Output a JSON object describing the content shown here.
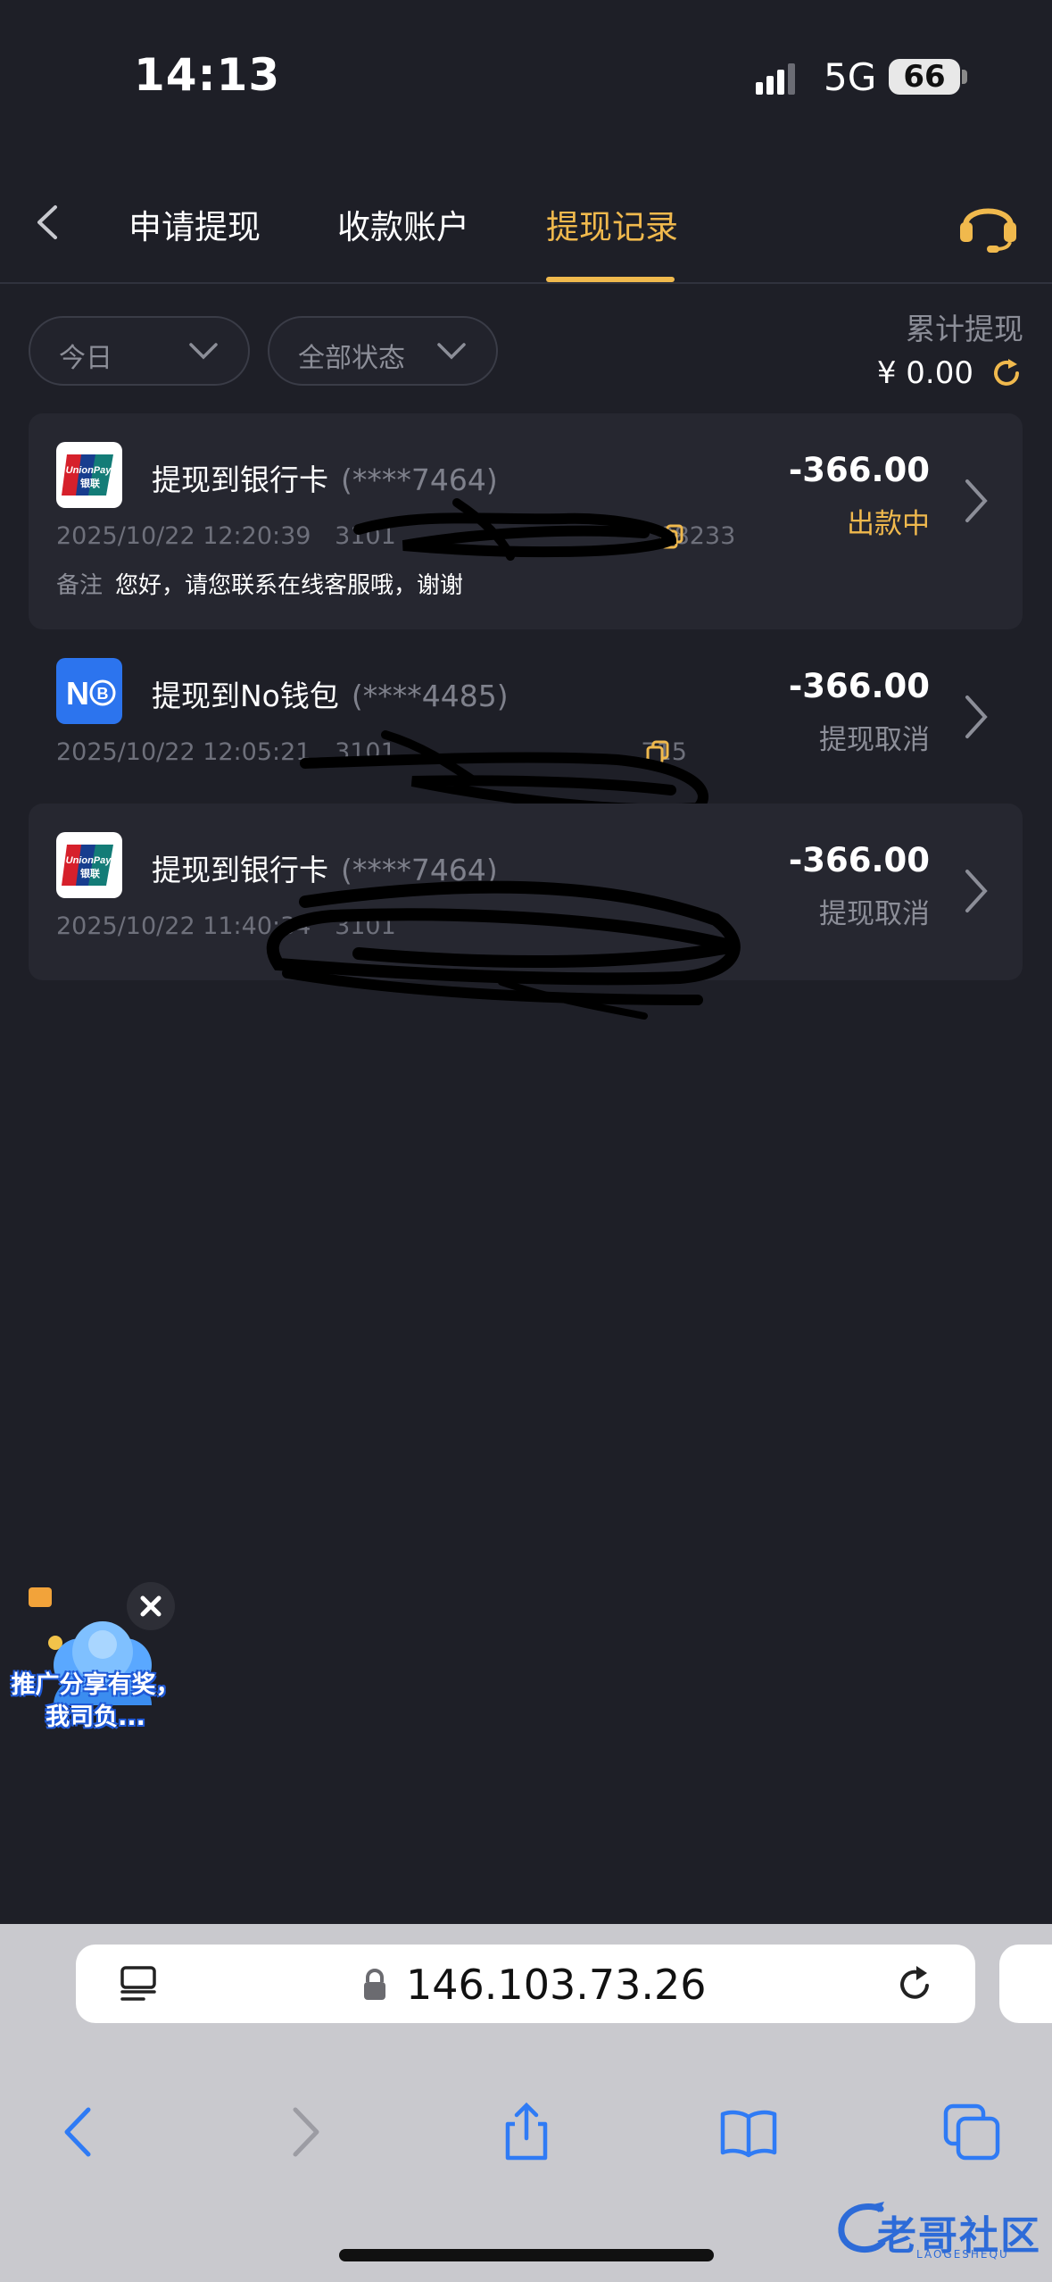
{
  "status_bar": {
    "time": "14:13",
    "network": "5G",
    "battery": "66"
  },
  "header": {
    "tabs": [
      {
        "label": "申请提现",
        "active": false
      },
      {
        "label": "收款账户",
        "active": false
      },
      {
        "label": "提现记录",
        "active": true
      }
    ],
    "back_icon": "chevron-left-icon",
    "support_icon": "headset-icon"
  },
  "filters": {
    "date": "今日",
    "status": "全部状态"
  },
  "summary": {
    "label": "累计提现",
    "amount": "¥ 0.00"
  },
  "records": [
    {
      "channel": "提现到银行卡",
      "account_mask": "(****7464)",
      "time": "2025/10/22 12:20:39",
      "order_visible": "3101",
      "order_tail": "08233",
      "note_label": "备注",
      "note": "您好，请您联系在线客服哦，谢谢",
      "amount": "-366.00",
      "status": "出款中"
    },
    {
      "channel": "提现到No钱包",
      "account_mask": "(****4485)",
      "time": "2025/10/22 12:05:21",
      "order_visible": "3101",
      "order_tail": "715",
      "amount": "-366.00",
      "status": "提现取消"
    },
    {
      "channel": "提现到银行卡",
      "account_mask": "(****7464)",
      "time": "2025/10/22 11:40:34",
      "order_visible": "3101",
      "amount": "-366.00",
      "status": "提现取消"
    }
  ],
  "logos": {
    "unionpay_text": "UnionPay",
    "unionpay_cn": "银联",
    "nowallet_text": "N"
  },
  "promo": {
    "text": "推广分享有奖，我司负..."
  },
  "browser": {
    "url": "146.103.73.26"
  },
  "watermark": {
    "text": "老哥社区",
    "sub": "LAOGESHEQU"
  },
  "colors": {
    "accent": "#f0b94d",
    "background": "#1e1f27",
    "card": "#262730"
  }
}
